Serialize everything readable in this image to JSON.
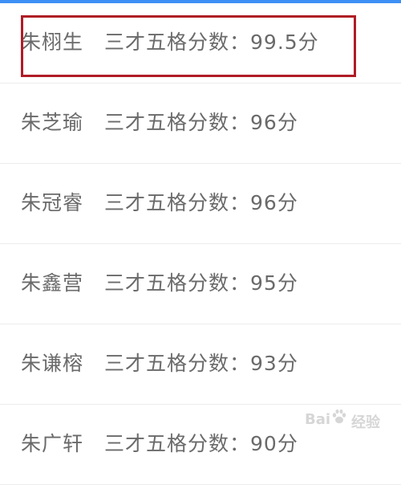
{
  "rows": [
    {
      "name": "朱栩生",
      "label": "三才五格分数：",
      "score": "99.5分"
    },
    {
      "name": "朱芝瑜",
      "label": "三才五格分数：",
      "score": "96分"
    },
    {
      "name": "朱冠睿",
      "label": "三才五格分数：",
      "score": "96分"
    },
    {
      "name": "朱鑫营",
      "label": "三才五格分数：",
      "score": "95分"
    },
    {
      "name": "朱谦榕",
      "label": "三才五格分数：",
      "score": "93分"
    },
    {
      "name": "朱广轩",
      "label": "三才五格分数：",
      "score": "90分"
    }
  ],
  "watermark": {
    "left": "Bai",
    "right": "经验"
  },
  "colors": {
    "text": "#6a6a6a",
    "highlight": "#b01c25",
    "top_strip": "#3d8ff5"
  }
}
